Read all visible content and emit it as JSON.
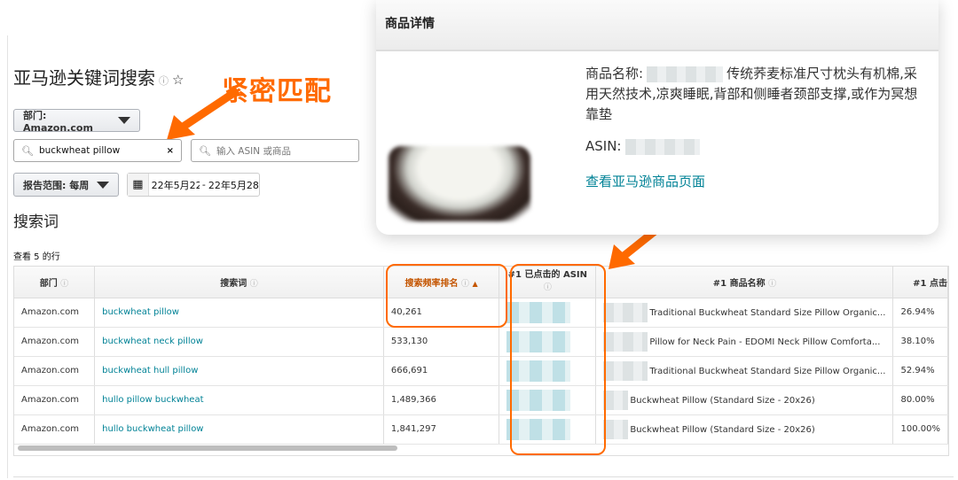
{
  "page": {
    "title": "亚马逊关键词搜索",
    "section_heading": "搜索词",
    "rows_label": "查看 5 的行"
  },
  "annotation": {
    "callout": "紧密匹配",
    "color": "#ff6a00"
  },
  "filters": {
    "department_label": "部门: Amazon.com",
    "search_value": "buckwheat pillow",
    "asin_placeholder": "输入 ASIN 或商品",
    "report_range_label": "报告范围: 每周",
    "date_start": "22年5月22",
    "date_sep": "-",
    "date_end": "22年5月28"
  },
  "table": {
    "headers": [
      "部门",
      "搜索词",
      "搜索频率排名",
      "#1 已点击的 ASIN",
      "#1 商品名称",
      "#1 点击"
    ],
    "rows": [
      {
        "dept": "Amazon.com",
        "term": "buckwheat pillow",
        "rank": "40,261",
        "product": "Traditional Buckwheat Standard Size Pillow Organic...",
        "share": "26.94%"
      },
      {
        "dept": "Amazon.com",
        "term": "buckwheat neck pillow",
        "rank": "533,130",
        "product": "Pillow for Neck Pain - EDOMI Neck Pillow Comforta...",
        "share": "38.10%"
      },
      {
        "dept": "Amazon.com",
        "term": "buckwheat hull pillow",
        "rank": "666,691",
        "product": "Traditional Buckwheat Standard Size Pillow Organic...",
        "share": "52.94%"
      },
      {
        "dept": "Amazon.com",
        "term": "hullo pillow buckwheat",
        "rank": "1,489,366",
        "product": "Buckwheat Pillow (Standard Size - 20x26)",
        "share": "80.00%"
      },
      {
        "dept": "Amazon.com",
        "term": "hullo buckwheat pillow",
        "rank": "1,841,297",
        "product": "Buckwheat Pillow (Standard Size - 20x26)",
        "share": "100.00%"
      }
    ]
  },
  "popup": {
    "title": "商品详情",
    "name_label": "商品名称:",
    "name_text": "传统荞麦标准尺寸枕头有机棉,采用天然技术,凉爽睡眠,背部和侧睡者颈部支撑,或作为冥想靠垫",
    "asin_label": "ASIN:",
    "link": "查看亚马逊商品页面"
  }
}
